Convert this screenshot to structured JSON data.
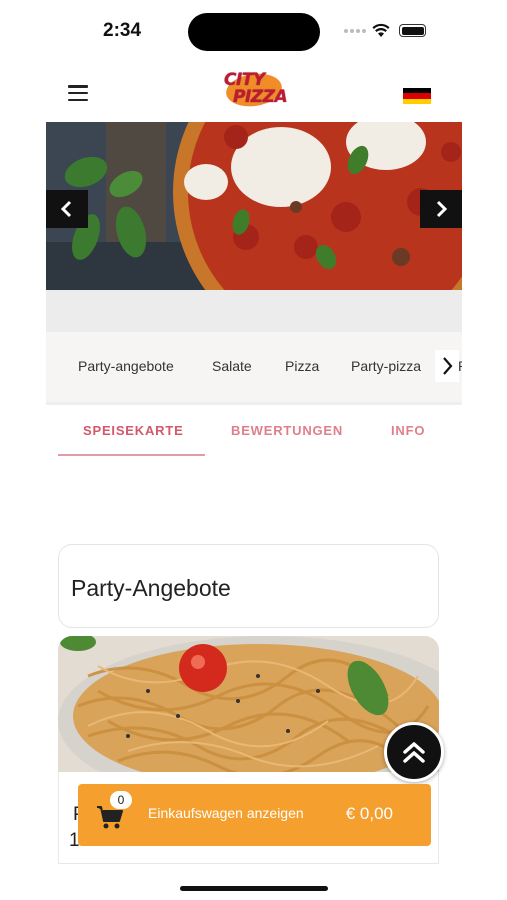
{
  "status_bar": {
    "time": "2:34"
  },
  "header": {
    "logo_line1": "CITY",
    "logo_line2": "PIZZA",
    "language_flag": "germany-flag",
    "menu_icon": "hamburger-menu-icon"
  },
  "hero": {
    "prev_icon": "chevron-left-icon",
    "next_icon": "chevron-right-icon"
  },
  "categories": {
    "items": [
      "Party-angebote",
      "Salate",
      "Pizza",
      "Party-pizza"
    ],
    "peek": "P",
    "next_icon": "chevron-right-icon"
  },
  "tabs": {
    "items": [
      "SPEISEKARTE",
      "BEWERTUNGEN",
      "INFO"
    ],
    "active": "SPEISEKARTE"
  },
  "section": {
    "title": "Party-Angebote"
  },
  "product": {
    "line1": "P",
    "line2": "1"
  },
  "cart": {
    "badge_count": "0",
    "label": "Einkaufswagen anzeigen",
    "total": "€ 0,00"
  },
  "colors": {
    "accent_orange": "#f5a02e",
    "tab_pink": "#e07f8c",
    "tab_active": "#d3586a",
    "flag_black": "#000000",
    "flag_red": "#dd0000",
    "flag_gold": "#ffce00"
  }
}
